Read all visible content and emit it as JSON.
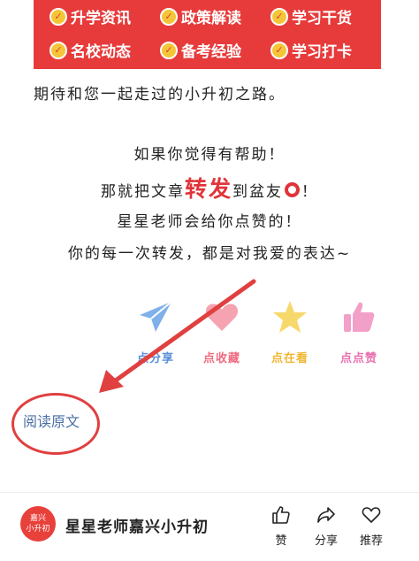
{
  "banner": {
    "tags": [
      "升学资讯",
      "政策解读",
      "学习干货",
      "名校动态",
      "备考经验",
      "学习打卡"
    ]
  },
  "intro": "期待和您一起走过的小升初之路。",
  "callout": {
    "line1": "如果你觉得有帮助！",
    "line2_prefix": "那就把文章",
    "line2_highlight": "转发",
    "line2_suffix_a": "到盆友",
    "line2_suffix_b": "！",
    "line3": "星星老师会给你点赞的！",
    "line4": "你的每一次转发，都是对我爱的表达~"
  },
  "actions": [
    {
      "label": "点分享",
      "icon": "paper-plane-icon",
      "color": "#7fb0ea"
    },
    {
      "label": "点收藏",
      "icon": "heart-icon",
      "color": "#f5a3b0"
    },
    {
      "label": "点在看",
      "icon": "star-icon",
      "color": "#f7d86a"
    },
    {
      "label": "点点赞",
      "icon": "thumbs-up-icon",
      "color": "#f3a0c8"
    }
  ],
  "read_more": "阅读原文",
  "footer": {
    "avatar_line1": "嘉兴",
    "avatar_line2": "小升初",
    "account_name": "星星老师嘉兴小升初",
    "buttons": [
      {
        "label": "赞",
        "icon": "thumbs-up-icon"
      },
      {
        "label": "分享",
        "icon": "share-icon"
      },
      {
        "label": "推荐",
        "icon": "heart-icon"
      }
    ]
  },
  "annotation_color": "#e04040"
}
